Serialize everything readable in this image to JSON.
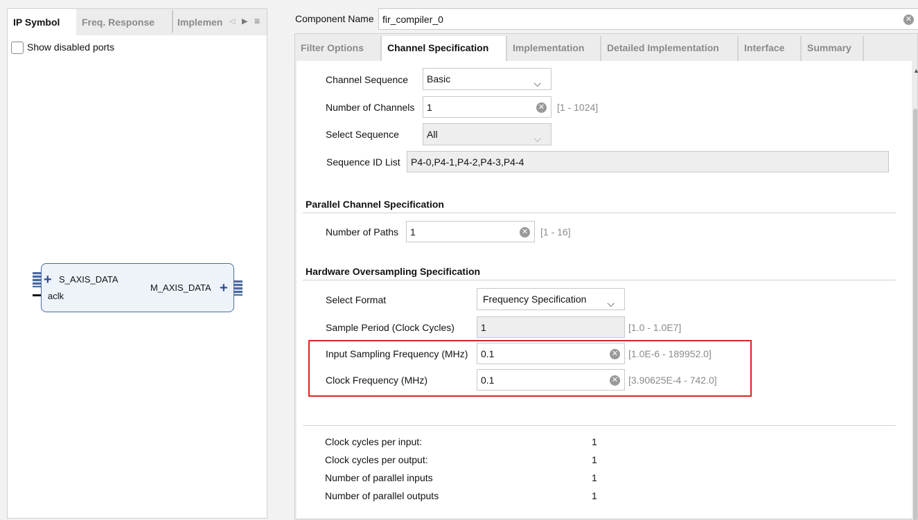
{
  "left_panel": {
    "tabs": [
      "IP Symbol",
      "Freq. Response",
      "Implemen"
    ],
    "show_disabled_ports": "Show disabled ports",
    "symbol": {
      "s_axis": "S_AXIS_DATA",
      "aclk": "aclk",
      "m_axis": "M_AXIS_DATA"
    }
  },
  "component": {
    "label": "Component Name",
    "value": "fir_compiler_0"
  },
  "tabs": [
    "Filter Options",
    "Channel Specification",
    "Implementation",
    "Detailed Implementation",
    "Interface",
    "Summary"
  ],
  "active_tab": "Channel Specification",
  "channel": {
    "sequence_label": "Channel Sequence",
    "sequence_value": "Basic",
    "num_channels_label": "Number of Channels",
    "num_channels_value": "1",
    "num_channels_range": "[1 - 1024]",
    "select_sequence_label": "Select Sequence",
    "select_sequence_value": "All",
    "seq_id_label": "Sequence ID List",
    "seq_id_value": "P4-0,P4-1,P4-2,P4-3,P4-4"
  },
  "parallel": {
    "title": "Parallel Channel Specification",
    "paths_label": "Number of Paths",
    "paths_value": "1",
    "paths_range": "[1 - 16]"
  },
  "oversampling": {
    "title": "Hardware Oversampling Specification",
    "format_label": "Select Format",
    "format_value": "Frequency Specification",
    "period_label": "Sample Period (Clock Cycles)",
    "period_value": "1",
    "period_range": "[1.0 - 1.0E7]",
    "input_freq_label": "Input Sampling Frequency (MHz)",
    "input_freq_value": "0.1",
    "input_freq_range": "[1.0E-6 - 189952.0]",
    "clock_freq_label": "Clock Frequency (MHz)",
    "clock_freq_value": "0.1",
    "clock_freq_range": "[3.90625E-4 - 742.0]",
    "highlight_color": "#e02020"
  },
  "summary": [
    {
      "label": "Clock cycles per input:",
      "value": "1"
    },
    {
      "label": "Clock cycles per output:",
      "value": "1"
    },
    {
      "label": "Number of parallel inputs",
      "value": "1"
    },
    {
      "label": "Number of parallel outputs",
      "value": "1"
    }
  ]
}
